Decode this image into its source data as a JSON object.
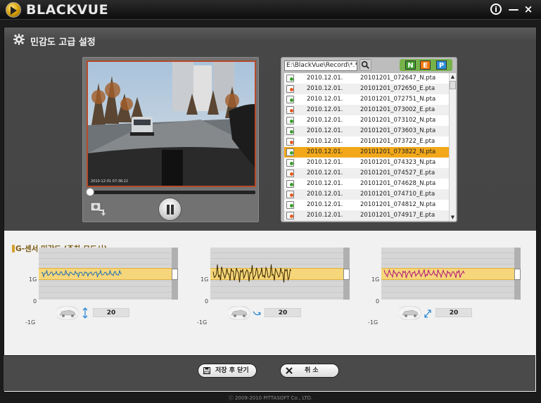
{
  "window": {
    "brand": "BLACKVUE",
    "info_glyph": "i",
    "min_glyph": "—",
    "close_glyph": "×"
  },
  "panel": {
    "title": "민감도 고급 설정"
  },
  "player": {
    "progress": 0.02,
    "state": "playing"
  },
  "files": {
    "path": "E:\\BlackVue\\Record\\*.*",
    "filters": [
      "N",
      "E",
      "P"
    ],
    "selected_index": 7,
    "rows": [
      {
        "date": "2010.12.01.",
        "name": "20101201_072647_N.pta",
        "type": "n"
      },
      {
        "date": "2010.12.01.",
        "name": "20101201_072650_E.pta",
        "type": "e"
      },
      {
        "date": "2010.12.01.",
        "name": "20101201_072751_N.pta",
        "type": "n"
      },
      {
        "date": "2010.12.01.",
        "name": "20101201_073002_E.pta",
        "type": "e"
      },
      {
        "date": "2010.12.01.",
        "name": "20101201_073102_N.pta",
        "type": "n"
      },
      {
        "date": "2010.12.01.",
        "name": "20101201_073603_N.pta",
        "type": "n"
      },
      {
        "date": "2010.12.01.",
        "name": "20101201_073722_E.pta",
        "type": "e"
      },
      {
        "date": "2010.12.01.",
        "name": "20101201_073822_N.pta",
        "type": "n"
      },
      {
        "date": "2010.12.01.",
        "name": "20101201_074323_N.pta",
        "type": "n"
      },
      {
        "date": "2010.12.01.",
        "name": "20101201_074527_E.pta",
        "type": "e"
      },
      {
        "date": "2010.12.01.",
        "name": "20101201_074628_N.pta",
        "type": "n"
      },
      {
        "date": "2010.12.01.",
        "name": "20101201_074710_E.pta",
        "type": "e"
      },
      {
        "date": "2010.12.01.",
        "name": "20101201_074812_N.pta",
        "type": "n"
      },
      {
        "date": "2010.12.01.",
        "name": "20101201_074917_E.pta",
        "type": "e"
      }
    ]
  },
  "gsensor": {
    "title": "G-센서 민감도 (주차 모드시)",
    "axis_labels": {
      "top": "1G",
      "mid": "0",
      "bottom": "-1G"
    },
    "graphs": [
      {
        "axis": "vertical",
        "value": "20",
        "color": "#1f6fb0"
      },
      {
        "axis": "horizontal",
        "value": "20",
        "color": "#3a2a00"
      },
      {
        "axis": "diagonal",
        "value": "20",
        "color": "#b0157a"
      }
    ]
  },
  "buttons": {
    "save_label": "저장 후 닫기",
    "cancel_label": "취 소"
  },
  "footer": "ⓒ 2009-2010 PITTASOFT Co., LTD."
}
